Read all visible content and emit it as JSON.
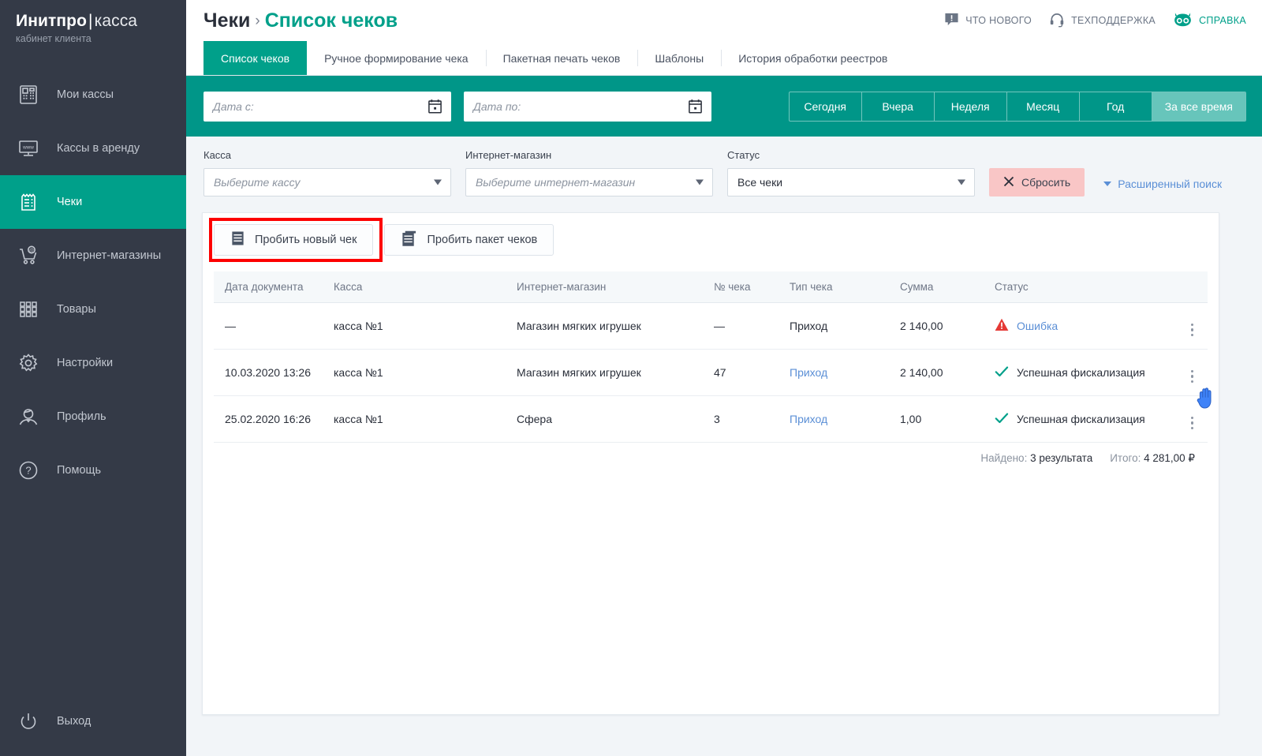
{
  "brand": {
    "name_bold": "Инитпро",
    "separator": "|",
    "name_light": "касса",
    "subtitle": "кабинет клиента"
  },
  "sidebar": {
    "items": [
      {
        "label": "Мои кассы",
        "icon": "cash-register-icon",
        "active": false
      },
      {
        "label": "Кассы в аренду",
        "icon": "monitor-www-icon",
        "active": false
      },
      {
        "label": "Чеки",
        "icon": "receipt-icon",
        "active": true
      },
      {
        "label": "Интернет-магазины",
        "icon": "cart-at-icon",
        "active": false
      },
      {
        "label": "Товары",
        "icon": "grid-icon",
        "active": false
      },
      {
        "label": "Настройки",
        "icon": "gear-icon",
        "active": false
      },
      {
        "label": "Профиль",
        "icon": "user-icon",
        "active": false
      },
      {
        "label": "Помощь",
        "icon": "question-circle-icon",
        "active": false
      }
    ],
    "logout": {
      "label": "Выход",
      "icon": "power-icon"
    }
  },
  "header": {
    "breadcrumb_root": "Чеки",
    "breadcrumb_sep": "›",
    "breadcrumb_current": "Список чеков",
    "links": [
      {
        "label": "ЧТО НОВОГО",
        "icon": "speech-bubble-alert-icon"
      },
      {
        "label": "ТЕХПОДДЕРЖКА",
        "icon": "headset-icon"
      },
      {
        "label": "СПРАВКА",
        "icon": "owl-icon"
      }
    ]
  },
  "tabs": [
    {
      "label": "Список чеков",
      "active": true
    },
    {
      "label": "Ручное формирование чека",
      "active": false
    },
    {
      "label": "Пакетная печать чеков",
      "active": false
    },
    {
      "label": "Шаблоны",
      "active": false
    },
    {
      "label": "История обработки реестров",
      "active": false
    }
  ],
  "filters": {
    "date_from": {
      "placeholder": "Дата с:",
      "value": "",
      "icon": "calendar-icon"
    },
    "date_to": {
      "placeholder": "Дата по:",
      "value": "",
      "icon": "calendar-icon"
    },
    "periods": [
      {
        "label": "Сегодня",
        "active": false
      },
      {
        "label": "Вчера",
        "active": false
      },
      {
        "label": "Неделя",
        "active": false
      },
      {
        "label": "Месяц",
        "active": false
      },
      {
        "label": "Год",
        "active": false
      },
      {
        "label": "За все время",
        "active": true
      }
    ],
    "kassa": {
      "label": "Касса",
      "placeholder": "Выберите кассу",
      "value": ""
    },
    "shop": {
      "label": "Интернет-магазин",
      "placeholder": "Выберите интернет-магазин",
      "value": ""
    },
    "status": {
      "label": "Статус",
      "value": "Все чеки"
    },
    "reset_button": {
      "label": "Сбросить",
      "icon": "close-x-icon",
      "color": "#f9c6c6"
    },
    "advanced_search": {
      "label": "Расширенный поиск",
      "color": "#5b8fd6"
    }
  },
  "actions": {
    "new_receipt": {
      "label": "Пробить новый чек",
      "icon": "receipt-icon",
      "highlighted": true
    },
    "batch_receipt": {
      "label": "Пробить пакет чеков",
      "icon": "receipts-stack-icon",
      "highlighted": false
    },
    "highlight_color": "#fd0000"
  },
  "table": {
    "columns": [
      "Дата документа",
      "Касса",
      "Интернет-магазин",
      "№ чека",
      "Тип чека",
      "Сумма",
      "Статус"
    ],
    "rows": [
      {
        "date": "—",
        "kassa": "касса №1",
        "shop": "Магазин мягких игрушек",
        "number": "—",
        "type": "Приход",
        "type_is_link": false,
        "sum": "2 140,00",
        "status": "Ошибка",
        "status_kind": "error",
        "status_icon": "warning-triangle-icon"
      },
      {
        "date": "10.03.2020 13:26",
        "kassa": "касса №1",
        "shop": "Магазин мягких игрушек",
        "number": "47",
        "type": "Приход",
        "type_is_link": true,
        "sum": "2 140,00",
        "status": "Успешная фискализация",
        "status_kind": "success",
        "status_icon": "check-icon"
      },
      {
        "date": "25.02.2020 16:26",
        "kassa": "касса №1",
        "shop": "Сфера",
        "number": "3",
        "type": "Приход",
        "type_is_link": true,
        "sum": "1,00",
        "status": "Успешная фискализация",
        "status_kind": "success",
        "status_icon": "check-icon"
      }
    ],
    "row_menu_icon": "kebab-menu-icon"
  },
  "summary": {
    "found_label": "Найдено:",
    "found_value": "3 результата",
    "total_label": "Итого:",
    "total_value": "4 281,00 ₽"
  },
  "colors": {
    "sidebar_bg": "#343a47",
    "accent_teal": "#00a08a",
    "band_teal": "#009688",
    "period_active": "#67c5bb",
    "link_blue": "#5b8fd6",
    "error_red": "#e53935",
    "success_green": "#00a08a",
    "highlight_red": "#fd0000",
    "page_bg": "#f2f5f8"
  },
  "cursor": {
    "icon": "hand-pointer-icon"
  }
}
